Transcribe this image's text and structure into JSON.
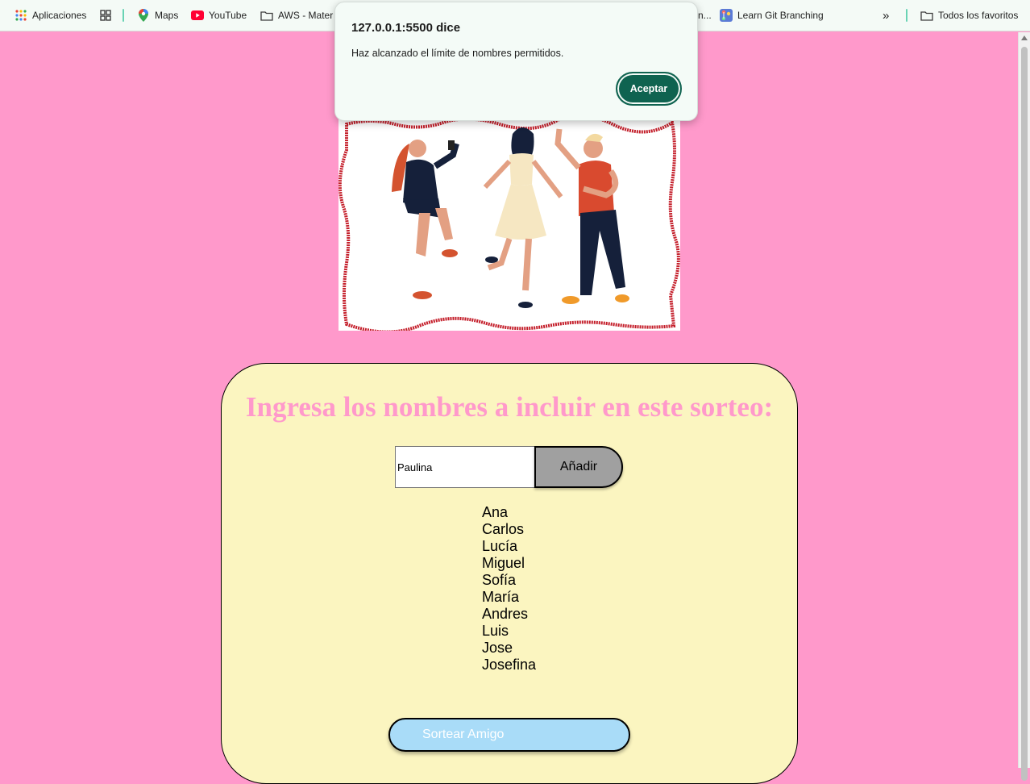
{
  "bookmarks": {
    "apps_label": "Aplicaciones",
    "maps_label": "Maps",
    "youtube_label": "YouTube",
    "aws_label": "AWS - Mater",
    "git_label": "Learn Git Branching",
    "overflow_label": "»",
    "favorites_label": "Todos los favoritos",
    "truncated_label": "n..."
  },
  "dialog": {
    "title": "127.0.0.1:5500 dice",
    "message": "Haz alcanzado el límite de nombres permitidos.",
    "accept_label": "Aceptar"
  },
  "main": {
    "heading": "Ingresa los nombres a incluir en este sorteo:",
    "input_value": "Paulina",
    "add_label": "Añadir",
    "names": [
      "Ana",
      "Carlos",
      "Lucía",
      "Miguel",
      "Sofía",
      "María",
      "Andres",
      "Luis",
      "Jose",
      "Josefina"
    ],
    "draw_label": "Sortear Amigo"
  },
  "colors": {
    "page_bg": "#ff99cb",
    "card_bg": "#fbf5c0",
    "heading": "#ff99cb",
    "dialog_button": "#0f6350",
    "add_button": "#a0a0a0",
    "draw_button": "#a9dcf8"
  }
}
